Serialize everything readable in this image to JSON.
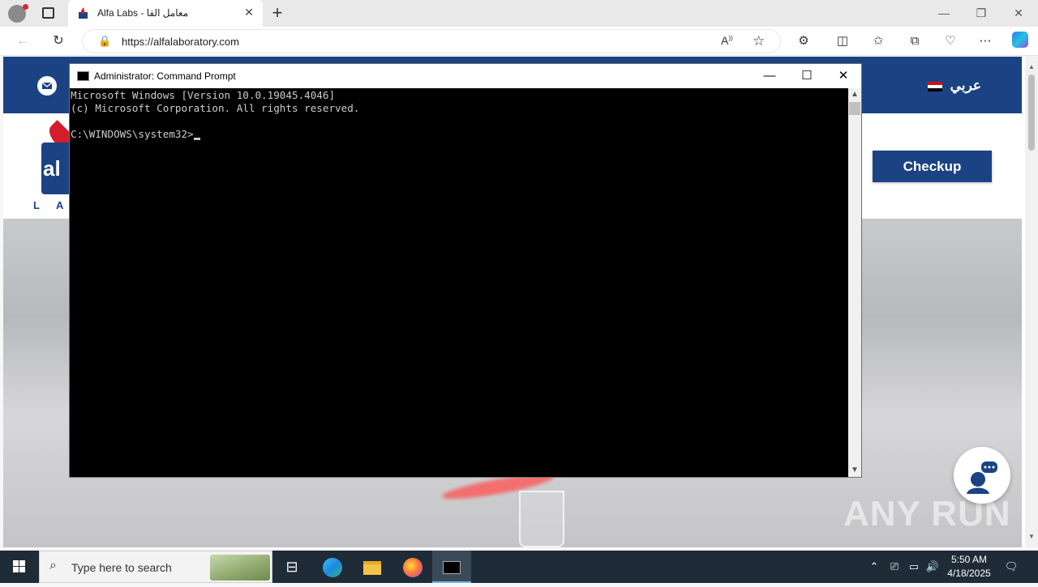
{
  "browser": {
    "tab_title": "Alfa Labs - معامل الفا",
    "tab_close": "✕",
    "new_tab": "+",
    "url": "https://alfalaboratory.com",
    "win_minimize": "—",
    "win_restore": "❐",
    "win_close": "✕"
  },
  "site": {
    "language_link": "عربي",
    "checkup_button": "Checkup",
    "logo_text": "al",
    "logo_subtext": "LA",
    "watermark": "ANY RUN"
  },
  "cmd": {
    "title": "Administrator: Command Prompt",
    "lines": [
      "Microsoft Windows [Version 10.0.19045.4046]",
      "(c) Microsoft Corporation. All rights reserved.",
      "",
      "C:\\WINDOWS\\system32>"
    ]
  },
  "taskbar": {
    "search_placeholder": "Type here to search",
    "time": "5:50 AM",
    "date": "4/18/2025"
  },
  "colors": {
    "brand_blue": "#1b4384",
    "brand_red": "#d51c2a",
    "taskbar": "#1f2c38"
  }
}
